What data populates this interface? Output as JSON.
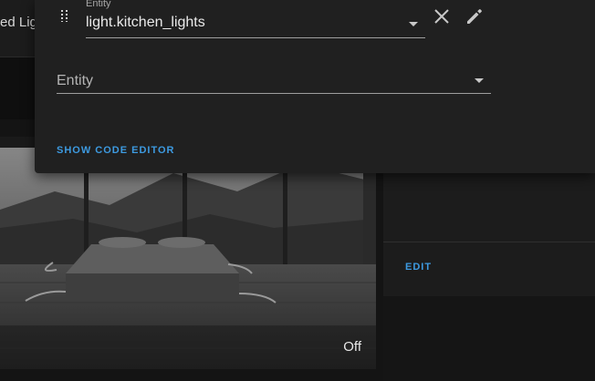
{
  "background": {
    "card_label_partial": "ed Lig",
    "picture_state": "Off",
    "edit_button_label": "EDIT"
  },
  "dialog": {
    "entity_row": {
      "label": "Entity",
      "value": "light.kitchen_lights"
    },
    "new_entity": {
      "label": "Entity"
    },
    "show_code_editor_label": "SHOW CODE EDITOR"
  },
  "icons": {
    "drag": "drag-handle-icon",
    "clear": "close-icon",
    "edit": "pencil-icon",
    "dropdown": "chevron-down-icon"
  },
  "colors": {
    "accent": "#3d9ae0",
    "dialog_bg": "#202020",
    "page_bg": "#141414"
  }
}
